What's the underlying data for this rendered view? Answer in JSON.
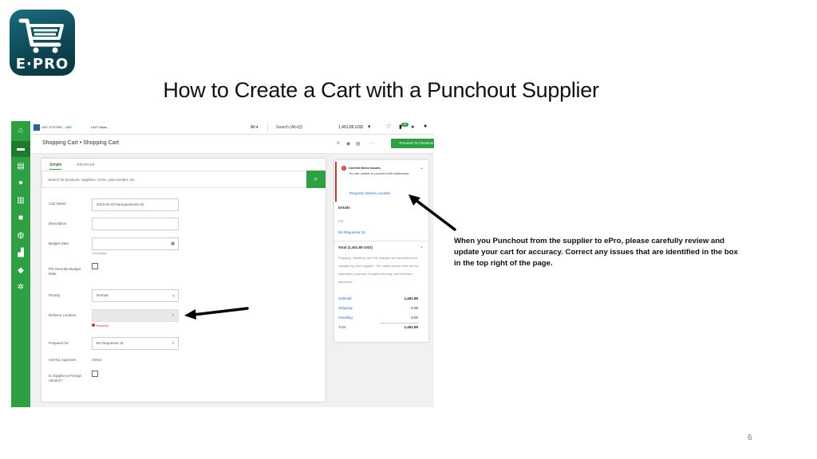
{
  "logo": {
    "text": "E·PRO"
  },
  "slide": {
    "title": "How to Create a Cart with a Punchout Supplier",
    "annotation": "When you Punchout from the supplier to ePro, please carefully review and update your cart for accuracy. Correct any issues that are identified in the box in the top right of the page.",
    "page_number": "6"
  },
  "app": {
    "topbar": {
      "brand1": "UNT SYSTEM",
      "brand2": "UNT",
      "brand3": "UNT Dallas",
      "scope": "All ▾",
      "search_label": "Search (Alt+Q)",
      "cart_total": "1,461.89 USD",
      "badge_count": "99"
    },
    "breadcrumb": "Shopping Cart  •  Shopping Cart",
    "checkout_button": "Proceed To Checkout",
    "tabs": [
      "Simple",
      "Advanced"
    ],
    "search_placeholder": "Search for products, suppliers, forms, part number, etc.",
    "form": {
      "cart_name_label": "Cart Name",
      "cart_name_value": "2023-04-03 barequestor01 01",
      "description_label": "Description",
      "budget_date_label": "Budget Date",
      "budget_date_hint": "mm/dd/yyyy",
      "pr_override_label": "PR Override Budget Date",
      "priority_label": "Priority",
      "priority_value": "Normal",
      "delivery_label": "Delivery Location",
      "required_text": "Required",
      "prepared_for_label": "Prepared for",
      "prepared_for_value": "BA Requestor 01",
      "adhoc_label": "Ad-Hoc Approver",
      "adhoc_link": "Select",
      "foreign_label": "Is Supplier a Foreign Vendor?"
    },
    "alert": {
      "title": "Correct these issues.",
      "body": "You are unable to proceed until addressed.",
      "link": "Required: Delivery Location"
    },
    "details": {
      "heading": "Details",
      "for_label": "For",
      "for_value": "BA Requestor 01"
    },
    "summary": {
      "total_heading": "Total (1,461.89 USD)",
      "note": "Shipping, Handling, and Tax charges are calculated and charged by each supplier. The values shown here are for estimation purposes, budget checking, and workflow approvals.",
      "subtotal_label": "Subtotal",
      "subtotal_value": "1,461.89",
      "shipping_label": "Shipping",
      "shipping_value": "0.00",
      "handling_label": "Handling",
      "handling_value": "0.00",
      "total_label": "Total",
      "total_value": "1,461.89"
    }
  }
}
